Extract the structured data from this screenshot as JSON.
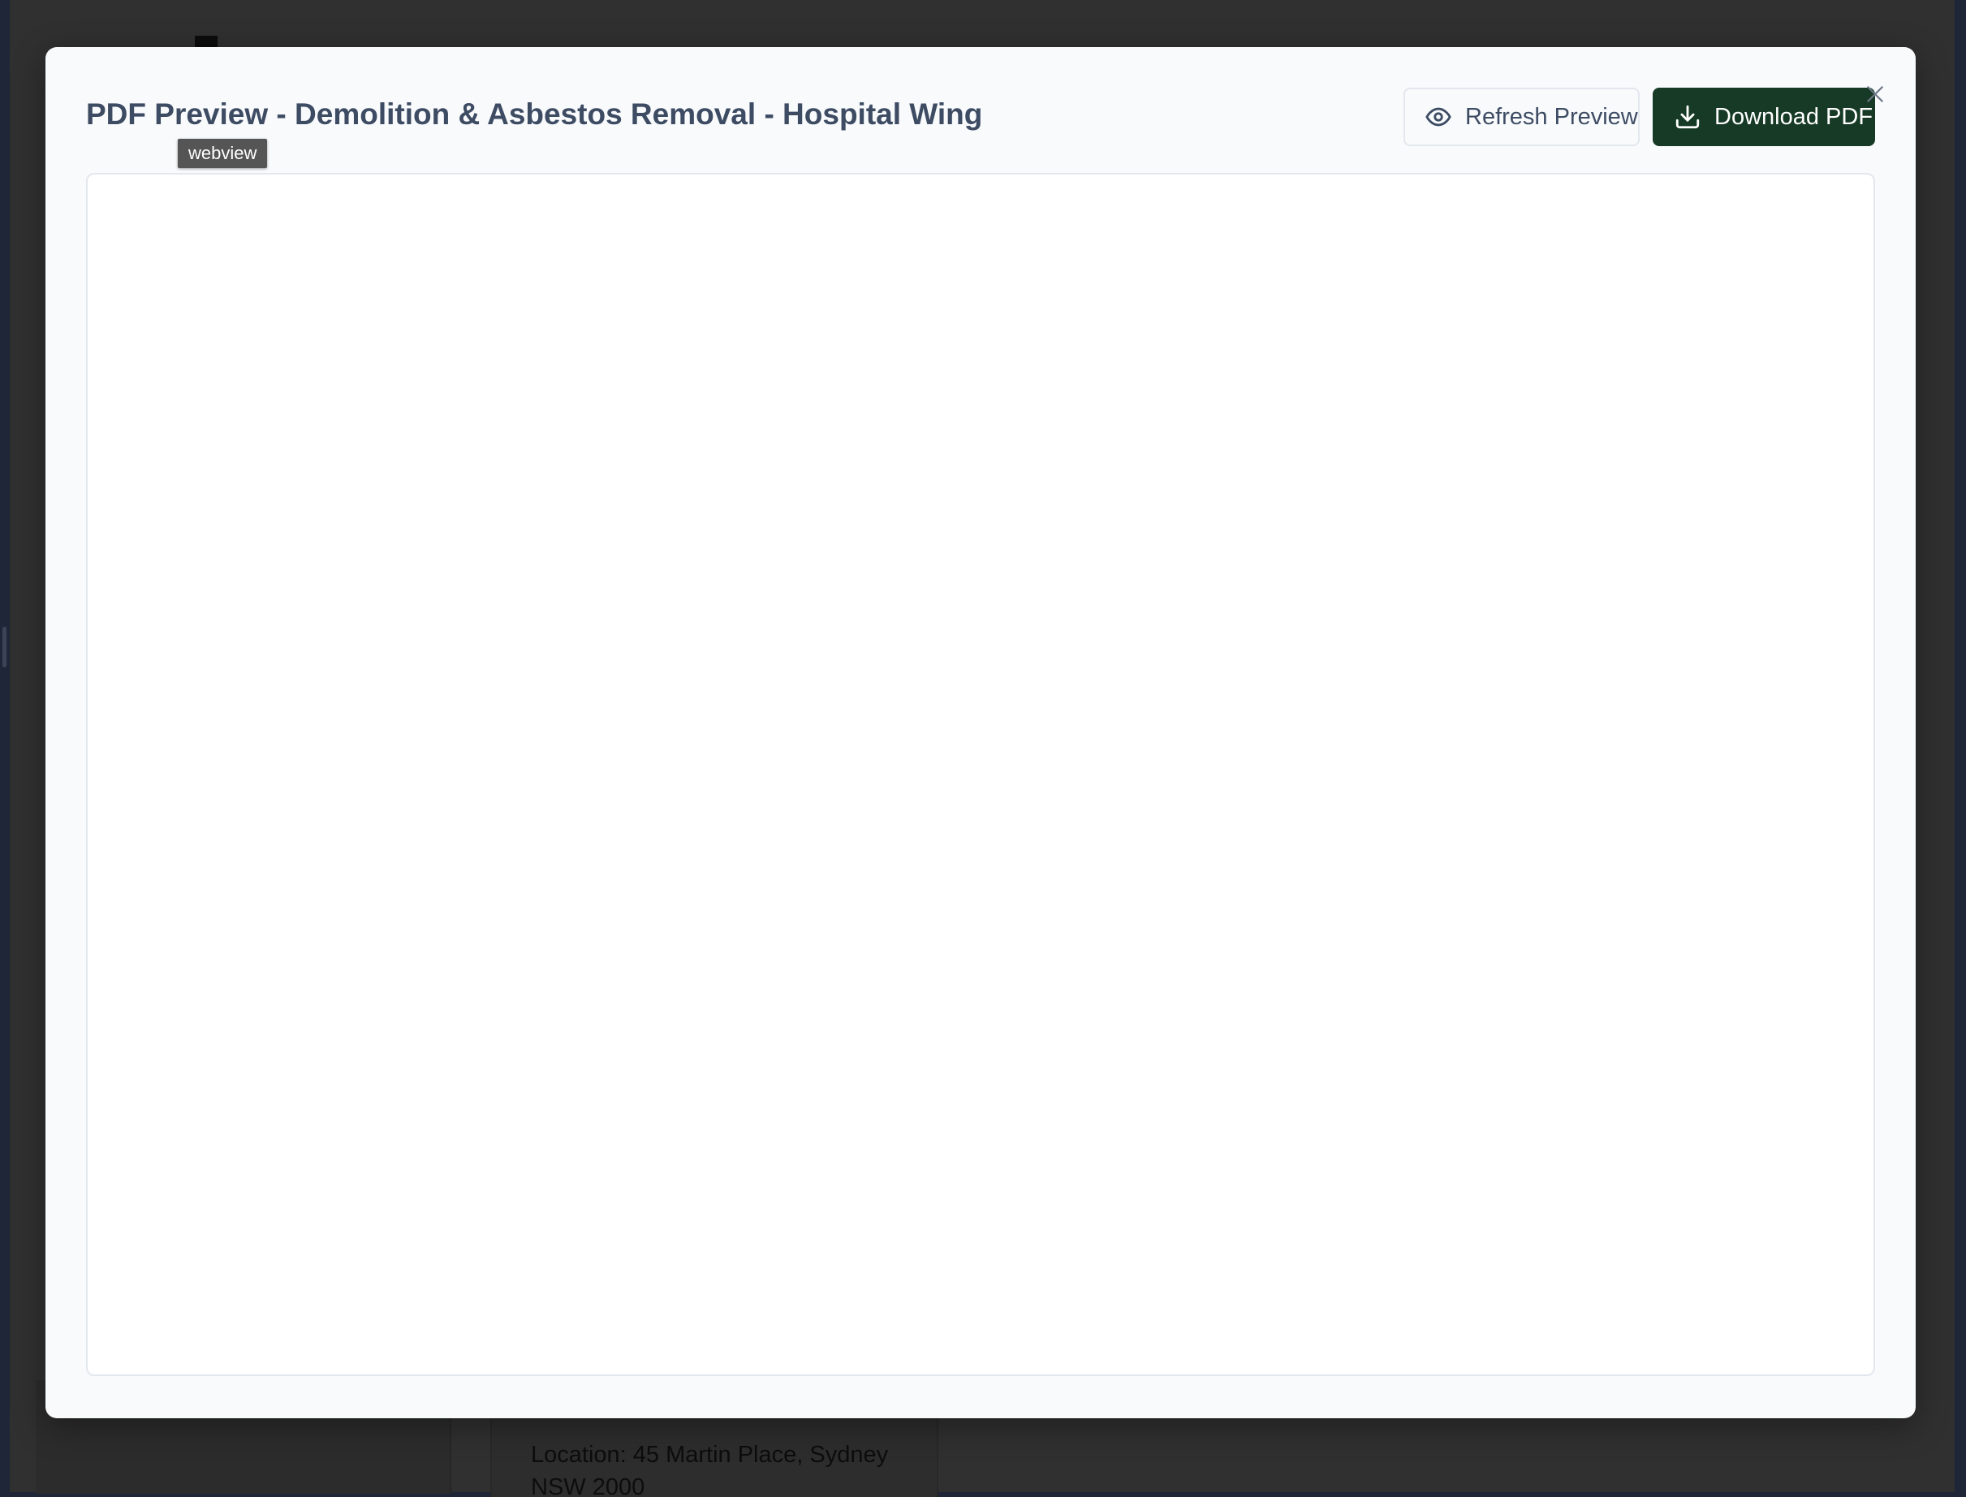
{
  "modal": {
    "title": "PDF Preview - Demolition & Asbestos Removal - Hospital Wing",
    "close_icon": "close-icon",
    "refresh_button": {
      "label": "Refresh Preview",
      "icon": "eye-icon"
    },
    "download_button": {
      "label": "Download PDF",
      "icon": "download-icon"
    },
    "tooltip": "webview"
  },
  "background": {
    "card_text": "Location: 45 Martin Place, Sydney NSW 2000"
  },
  "colors": {
    "primary_button": "#163a25",
    "title_text": "#3d4b63",
    "modal_bg": "#f8fafc",
    "overlay": "#303030"
  }
}
